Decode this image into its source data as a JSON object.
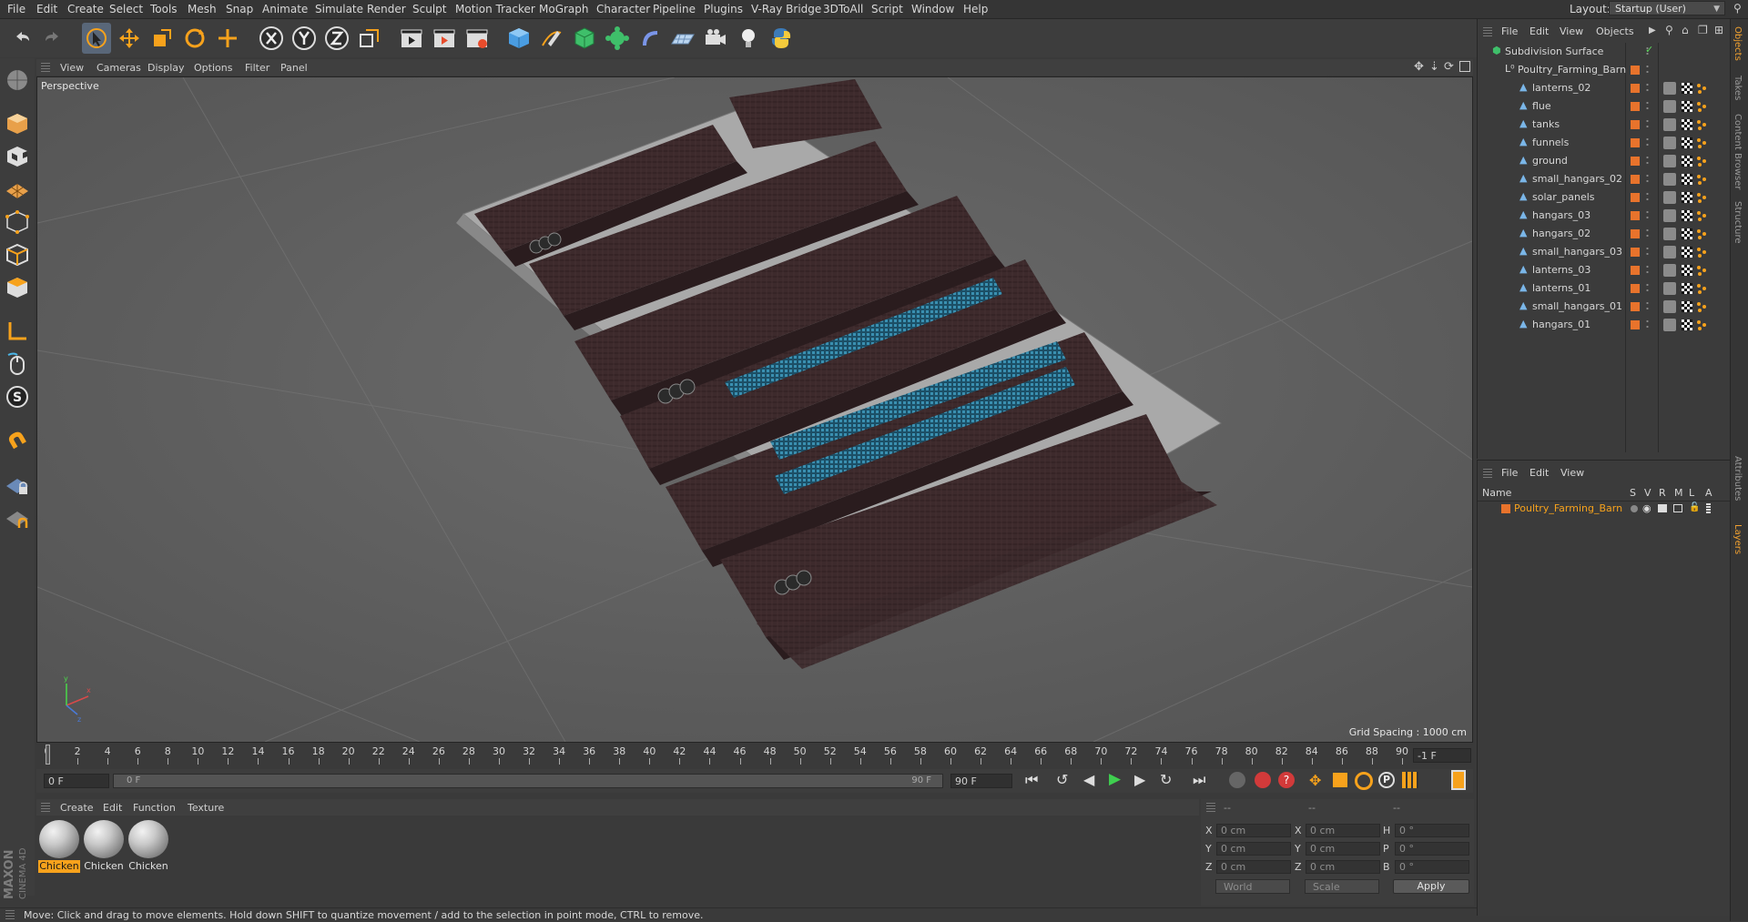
{
  "menu": [
    "File",
    "Edit",
    "Create",
    "Select",
    "Tools",
    "Mesh",
    "Snap",
    "Animate",
    "Simulate",
    "Render",
    "Sculpt",
    "Motion Tracker",
    "MoGraph",
    "Character",
    "Pipeline",
    "Plugins",
    "V-Ray Bridge",
    "3DToAll",
    "Script",
    "Window",
    "Help"
  ],
  "layout": {
    "label": "Layout:",
    "value": "Startup (User)"
  },
  "viewport": {
    "menu": [
      "View",
      "Cameras",
      "Display",
      "Options",
      "Filter",
      "Panel"
    ],
    "label": "Perspective",
    "grid_spacing": "Grid Spacing : 1000 cm"
  },
  "timeline": {
    "ticks": [
      "0",
      "2",
      "4",
      "6",
      "8",
      "10",
      "12",
      "14",
      "16",
      "18",
      "20",
      "22",
      "24",
      "26",
      "28",
      "30",
      "32",
      "34",
      "36",
      "38",
      "40",
      "42",
      "44",
      "46",
      "48",
      "50",
      "52",
      "54",
      "56",
      "58",
      "60",
      "62",
      "64",
      "66",
      "68",
      "70",
      "72",
      "74",
      "76",
      "78",
      "80",
      "82",
      "84",
      "86",
      "88",
      "90"
    ],
    "current_frame": "-1 F",
    "start_field": "0 F",
    "range_start": "0 F",
    "range_end": "90 F",
    "end_field": "90 F"
  },
  "materials": {
    "menu": [
      "Create",
      "Edit",
      "Function",
      "Texture"
    ],
    "items": [
      {
        "label": "Chicken",
        "active": true
      },
      {
        "label": "Chicken",
        "active": false
      },
      {
        "label": "Chicken",
        "active": false
      }
    ]
  },
  "coordinates": {
    "header": [
      "--",
      "--",
      "--"
    ],
    "rows": [
      {
        "k1": "X",
        "v1": "0 cm",
        "k2": "X",
        "v2": "0 cm",
        "k3": "H",
        "v3": "0 °"
      },
      {
        "k1": "Y",
        "v1": "0 cm",
        "k2": "Y",
        "v2": "0 cm",
        "k3": "P",
        "v3": "0 °"
      },
      {
        "k1": "Z",
        "v1": "0 cm",
        "k2": "Z",
        "v2": "0 cm",
        "k3": "B",
        "v3": "0 °"
      }
    ],
    "world": "World",
    "scale": "Scale",
    "apply": "Apply"
  },
  "status": "Move: Click and drag to move elements. Hold down SHIFT to quantize movement / add to the selection in point mode, CTRL to remove.",
  "objects": {
    "menu": [
      "File",
      "Edit",
      "View",
      "Objects"
    ],
    "root": "Subdivision Surface",
    "group": "Poultry_Farming_Barn",
    "children": [
      "lanterns_02",
      "flue",
      "tanks",
      "funnels",
      "ground",
      "small_hangars_02",
      "solar_panels",
      "hangars_03",
      "hangars_02",
      "small_hangars_03",
      "lanterns_03",
      "lanterns_01",
      "small_hangars_01",
      "hangars_01"
    ]
  },
  "layers": {
    "menu": [
      "File",
      "Edit",
      "View"
    ],
    "columns": {
      "name": "Name",
      "flags": [
        "S",
        "V",
        "R",
        "M",
        "L",
        "A"
      ]
    },
    "items": [
      "Poultry_Farming_Barn"
    ]
  },
  "side_tabs": [
    "Objects",
    "Takes",
    "Content Browser",
    "Structure",
    "Attributes",
    "Layers"
  ],
  "brand": {
    "top": "MAXON",
    "bottom": "CINEMA 4D"
  },
  "colors": {
    "accent": "#f7a21c",
    "selection": "#596779",
    "object_tag": "#e8732c"
  }
}
